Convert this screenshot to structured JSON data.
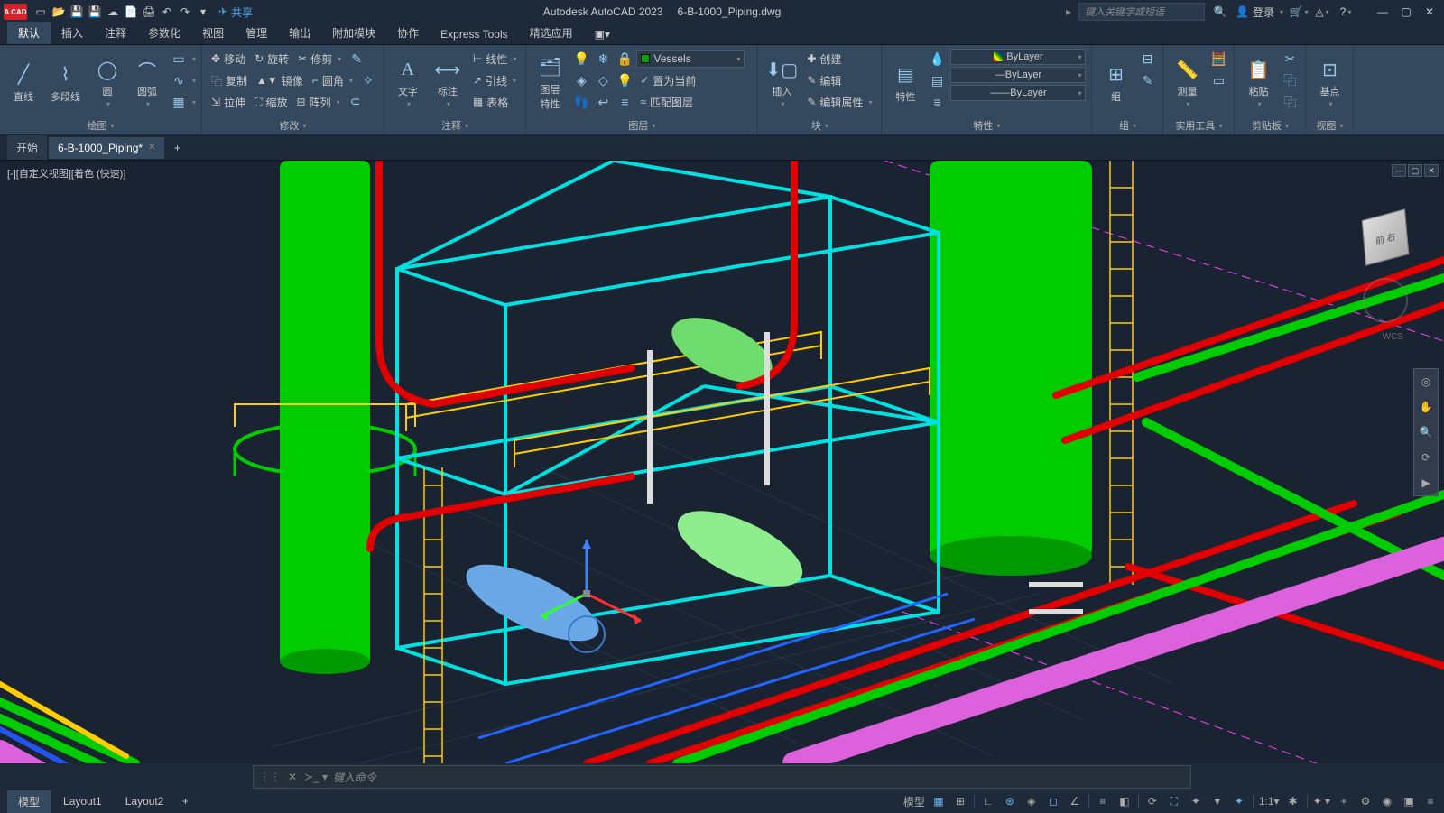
{
  "app": {
    "name": "Autodesk AutoCAD 2023",
    "document": "6-B-1000_Piping.dwg",
    "share": "共享",
    "login": "登录",
    "search_placeholder": "键入关键字或短语"
  },
  "ribbon_tabs": [
    "默认",
    "插入",
    "注释",
    "参数化",
    "视图",
    "管理",
    "输出",
    "附加模块",
    "协作",
    "Express Tools",
    "精选应用"
  ],
  "ribbon": {
    "draw": {
      "label": "绘图",
      "line": "直线",
      "polyline": "多段线",
      "circle": "圆",
      "arc": "圆弧"
    },
    "modify": {
      "label": "修改",
      "move": "移动",
      "rotate": "旋转",
      "trim": "修剪",
      "copy": "复制",
      "mirror": "镜像",
      "fillet": "圆角",
      "stretch": "拉伸",
      "scale": "缩放",
      "array": "阵列"
    },
    "annotation": {
      "label": "注释",
      "text": "文字",
      "dim": "标注",
      "linear": "线性",
      "leader": "引线",
      "table": "表格"
    },
    "layers": {
      "label": "图层",
      "btn": "图层\n特性",
      "current": "Vessels",
      "make_current": "置为当前",
      "match": "匹配图层"
    },
    "block": {
      "label": "块",
      "insert": "插入",
      "create": "创建",
      "edit": "编辑",
      "attr": "编辑属性"
    },
    "properties": {
      "label": "特性",
      "btn": "特性",
      "bylayer": "ByLayer"
    },
    "group": {
      "label": "组",
      "btn": "组"
    },
    "utilities": {
      "label": "实用工具",
      "measure": "测量"
    },
    "clipboard": {
      "label": "剪贴板",
      "paste": "粘贴"
    },
    "view": {
      "label": "视图",
      "base": "基点"
    }
  },
  "file_tabs": {
    "start": "开始",
    "doc": "6-B-1000_Piping*"
  },
  "viewport": {
    "label": "[-][自定义视图][着色 (快速)]",
    "cube_face": "前 右",
    "wcs": "WCS"
  },
  "cmdline": {
    "placeholder": "键入命令"
  },
  "layout_tabs": [
    "模型",
    "Layout1",
    "Layout2"
  ],
  "status": {
    "model": "模型",
    "scale": "1:1"
  }
}
